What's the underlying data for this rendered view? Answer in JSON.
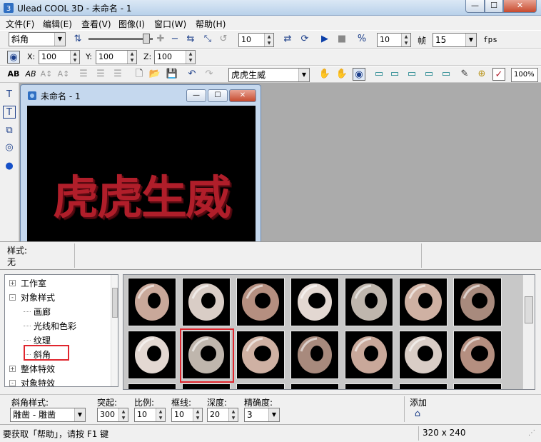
{
  "window": {
    "title": "Ulead COOL 3D - 未命名 - 1",
    "minimize": "—",
    "maximize": "☐",
    "close": "✕"
  },
  "menu": [
    "文件(F)",
    "编辑(E)",
    "查看(V)",
    "图像(I)",
    "窗口(W)",
    "帮助(H)"
  ],
  "toolbar1": {
    "object_combo": "斜角",
    "frame_value": "10",
    "frame_count": "10",
    "frame_label": "帧",
    "fps_value": "15",
    "fps_label": "fps"
  },
  "toolbar2": {
    "x_label": "X:",
    "x_value": "100",
    "y_label": "Y:",
    "y_value": "100",
    "z_label": "Z:",
    "z_value": "100"
  },
  "toolbar3": {
    "text_combo": "虎虎生威",
    "zoom": "100%"
  },
  "document": {
    "title": "未命名 - 1",
    "canvas_text": "虎虎生威"
  },
  "style_panel": {
    "label": "样式:",
    "value": "无"
  },
  "tree": {
    "items": [
      {
        "label": "工作室",
        "expander": "+",
        "level": 0
      },
      {
        "label": "对象样式",
        "expander": "-",
        "level": 0
      },
      {
        "label": "画廊",
        "expander": "",
        "level": 1
      },
      {
        "label": "光线和色彩",
        "expander": "",
        "level": 1
      },
      {
        "label": "纹理",
        "expander": "",
        "level": 1
      },
      {
        "label": "斜角",
        "expander": "",
        "level": 1
      },
      {
        "label": "整体特效",
        "expander": "+",
        "level": 0
      },
      {
        "label": "对象特效",
        "expander": "-",
        "level": 0
      }
    ]
  },
  "gallery": {
    "highlight_row": 2,
    "highlight_col": 2,
    "rows": 3,
    "cols": 7
  },
  "params": {
    "bevel_style_label": "斜角样式:",
    "bevel_style_value": "雕凿 - 雕凿",
    "bulge_label": "突起:",
    "bulge_value": "300",
    "ratio_label": "比例:",
    "ratio_value": "10",
    "border_label": "框线:",
    "border_value": "10",
    "depth_label": "深度:",
    "depth_value": "20",
    "precision_label": "精确度:",
    "precision_value": "3",
    "add_label": "添加"
  },
  "statusbar": {
    "help_text": "要获取「帮助」，请按 F1 键",
    "size": "320 x 240"
  }
}
